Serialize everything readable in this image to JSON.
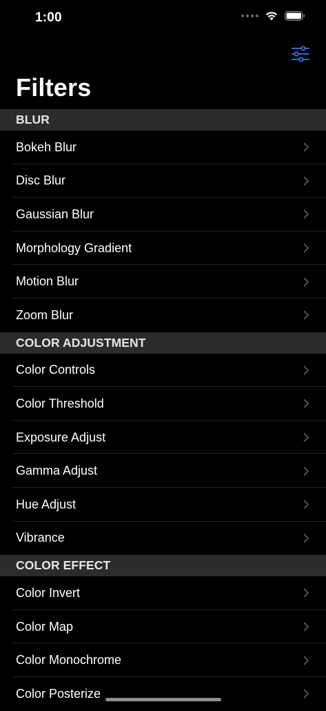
{
  "status_bar": {
    "time": "1:00"
  },
  "nav": {
    "title": "Filters",
    "accent_color": "#3478f6"
  },
  "sections": [
    {
      "header": "BLUR",
      "items": [
        "Bokeh Blur",
        "Disc Blur",
        "Gaussian Blur",
        "Morphology Gradient",
        "Motion Blur",
        "Zoom Blur"
      ]
    },
    {
      "header": "COLOR ADJUSTMENT",
      "items": [
        "Color Controls",
        "Color Threshold",
        "Exposure Adjust",
        "Gamma Adjust",
        "Hue Adjust",
        "Vibrance"
      ]
    },
    {
      "header": "COLOR EFFECT",
      "items": [
        "Color Invert",
        "Color Map",
        "Color Monochrome",
        "Color Posterize"
      ]
    }
  ]
}
